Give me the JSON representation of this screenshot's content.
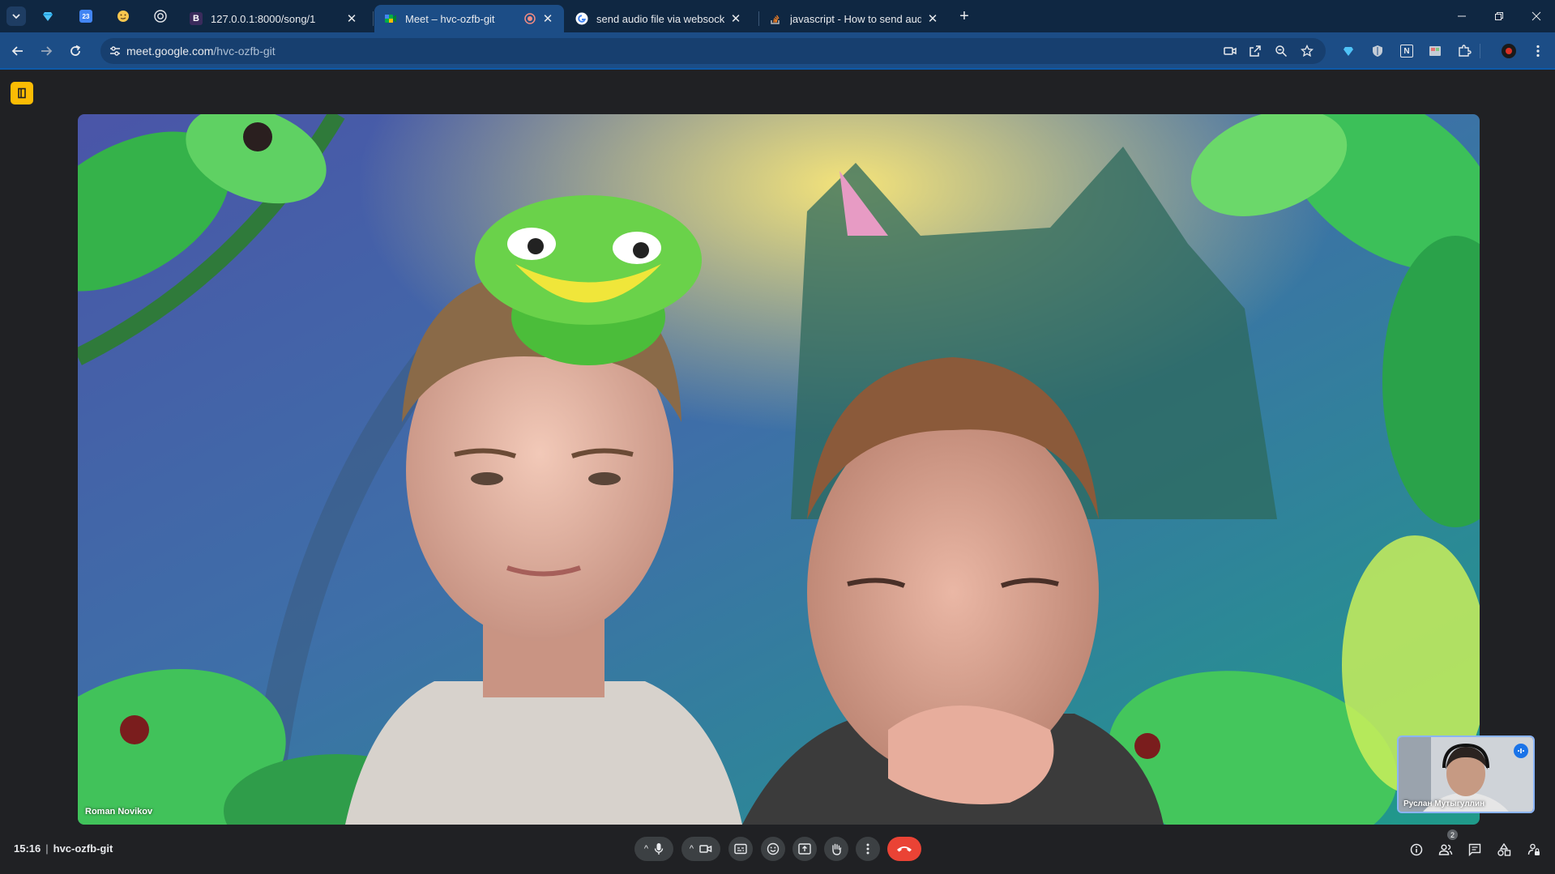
{
  "browser": {
    "tabs": [
      {
        "title": "127.0.0.1:8000/song/1",
        "favicon_letter": "B",
        "favicon_color": "#3a2b5c",
        "active": false
      },
      {
        "title": "Meet – hvc-ozfb-git",
        "active": true,
        "recording": true
      },
      {
        "title": "send audio file via websocket d",
        "favicon": "google-icon",
        "active": false
      },
      {
        "title": "javascript - How to send audio",
        "favicon": "stackoverflow-icon",
        "active": false
      }
    ],
    "pinned_tabs": [
      "gem-icon",
      "calendar-icon",
      "emoji-icon",
      "openai-icon"
    ],
    "calendar_day": "23",
    "url_host": "meet.google.com",
    "url_path": "/hvc-ozfb-git",
    "colors": {
      "tabstrip": "#0f2742",
      "toolbar": "#1c4d86",
      "active_tab": "#1c4d86"
    }
  },
  "meet": {
    "main_participant": "Roman Novikov",
    "self_participant": "Руслан Мутыгуллин",
    "time": "15:16",
    "meeting_code": "hvc-ozfb-git",
    "people_count": "2",
    "hangup_color": "#ea4335"
  }
}
